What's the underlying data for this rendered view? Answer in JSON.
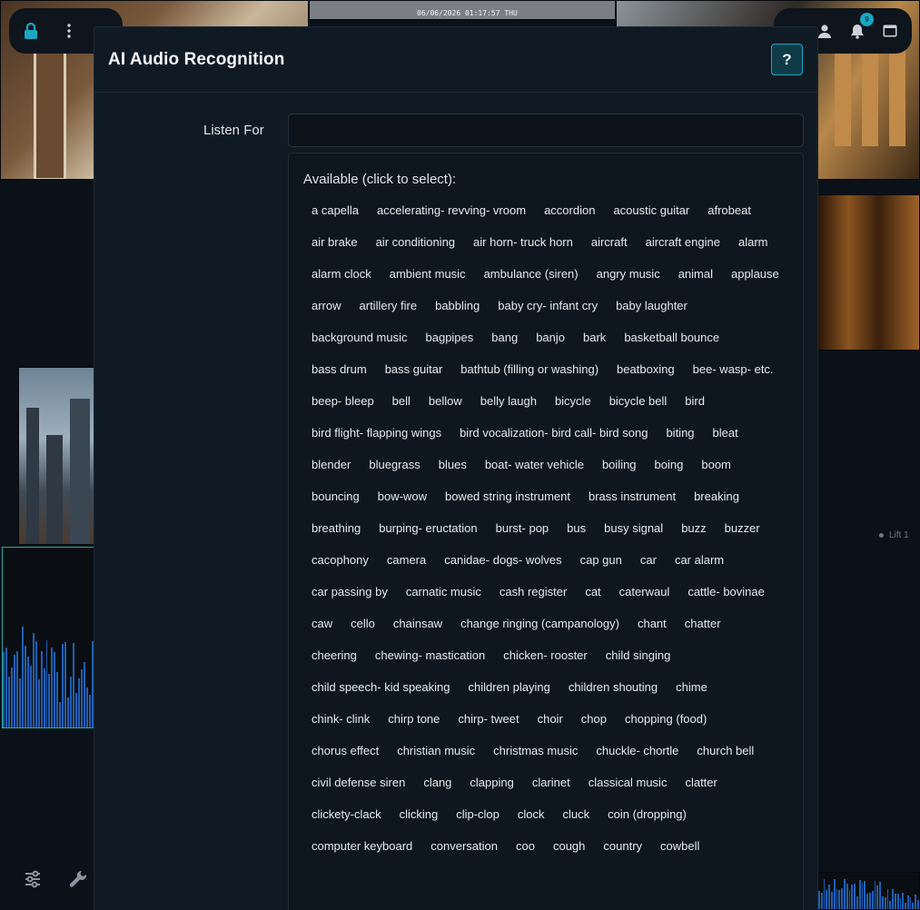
{
  "camera": {
    "timestamp": "06/06/2026 01:17:57 THU",
    "lift_label": "Lift 1"
  },
  "topbar": {
    "notification_count": "9"
  },
  "modal": {
    "title": "AI Audio Recognition",
    "help_label": "?",
    "listen_for_label": "Listen For",
    "listen_for_value": "",
    "available_heading": "Available (click to select):",
    "tags": [
      "a capella",
      "accelerating- revving- vroom",
      "accordion",
      "acoustic guitar",
      "afrobeat",
      "air brake",
      "air conditioning",
      "air horn- truck horn",
      "aircraft",
      "aircraft engine",
      "alarm",
      "alarm clock",
      "ambient music",
      "ambulance (siren)",
      "angry music",
      "animal",
      "applause",
      "arrow",
      "artillery fire",
      "babbling",
      "baby cry- infant cry",
      "baby laughter",
      "background music",
      "bagpipes",
      "bang",
      "banjo",
      "bark",
      "basketball bounce",
      "bass drum",
      "bass guitar",
      "bathtub (filling or washing)",
      "beatboxing",
      "bee- wasp- etc.",
      "beep- bleep",
      "bell",
      "bellow",
      "belly laugh",
      "bicycle",
      "bicycle bell",
      "bird",
      "bird flight- flapping wings",
      "bird vocalization- bird call- bird song",
      "biting",
      "bleat",
      "blender",
      "bluegrass",
      "blues",
      "boat- water vehicle",
      "boiling",
      "boing",
      "boom",
      "bouncing",
      "bow-wow",
      "bowed string instrument",
      "brass instrument",
      "breaking",
      "breathing",
      "burping- eructation",
      "burst- pop",
      "bus",
      "busy signal",
      "buzz",
      "buzzer",
      "cacophony",
      "camera",
      "canidae- dogs- wolves",
      "cap gun",
      "car",
      "car alarm",
      "car passing by",
      "carnatic music",
      "cash register",
      "cat",
      "caterwaul",
      "cattle- bovinae",
      "caw",
      "cello",
      "chainsaw",
      "change ringing (campanology)",
      "chant",
      "chatter",
      "cheering",
      "chewing- mastication",
      "chicken- rooster",
      "child singing",
      "child speech- kid speaking",
      "children playing",
      "children shouting",
      "chime",
      "chink- clink",
      "chirp tone",
      "chirp- tweet",
      "choir",
      "chop",
      "chopping (food)",
      "chorus effect",
      "christian music",
      "christmas music",
      "chuckle- chortle",
      "church bell",
      "civil defense siren",
      "clang",
      "clapping",
      "clarinet",
      "classical music",
      "clatter",
      "clickety-clack",
      "clicking",
      "clip-clop",
      "clock",
      "cluck",
      "coin (dropping)",
      "computer keyboard",
      "conversation",
      "coo",
      "cough",
      "country",
      "cowbell"
    ]
  }
}
